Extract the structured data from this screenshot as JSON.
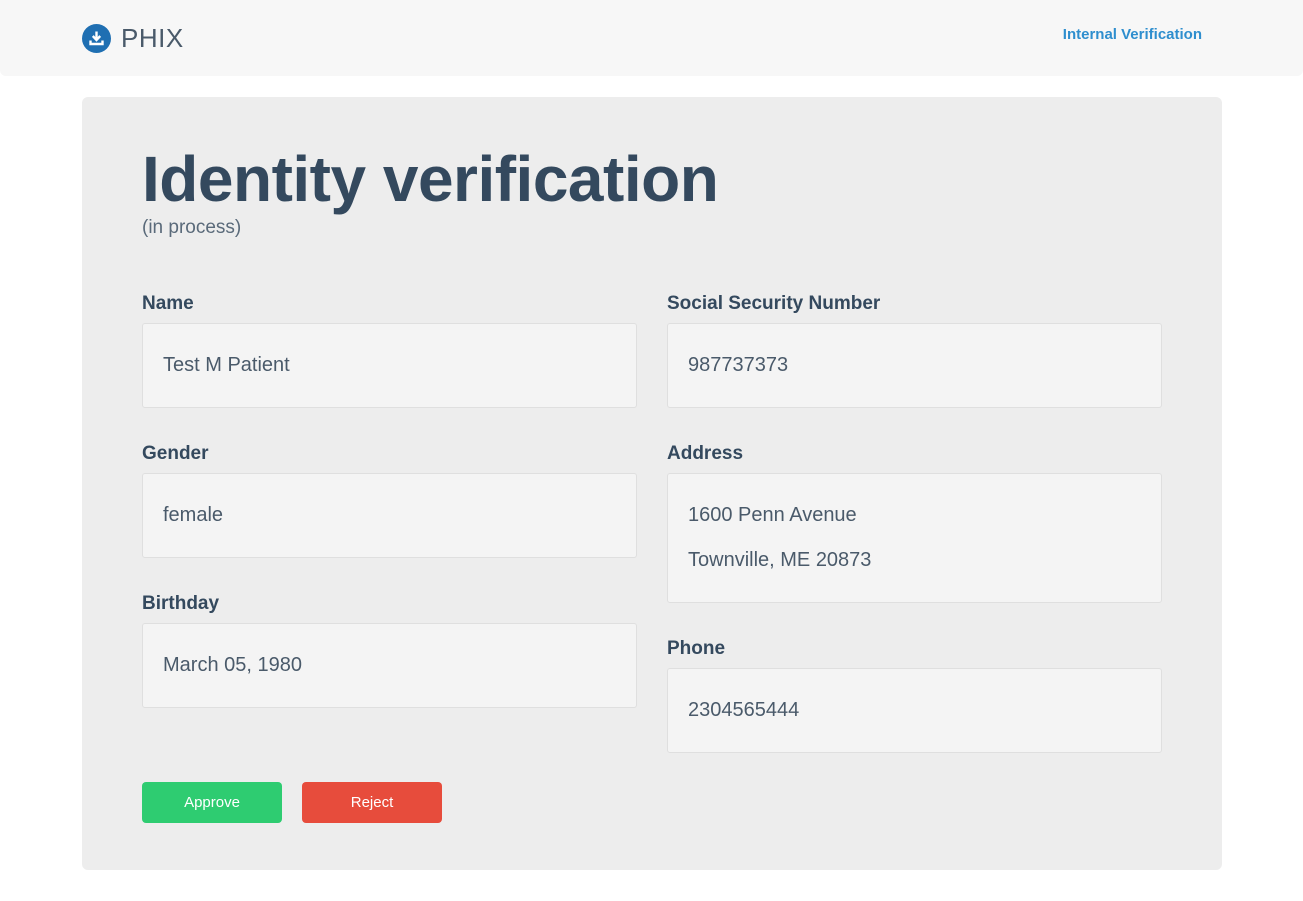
{
  "header": {
    "brand": "PHIX",
    "brand_icon": "download-icon",
    "nav_link": "Internal Verification",
    "colors": {
      "brand_icon": "#1f6fb2",
      "link": "#2e8ece"
    }
  },
  "main": {
    "title": "Identity verification",
    "subtitle": "(in process)",
    "fields": {
      "name": {
        "label": "Name",
        "value": "Test M Patient"
      },
      "ssn": {
        "label": "Social Security Number",
        "value": "987737373"
      },
      "gender": {
        "label": "Gender",
        "value": "female"
      },
      "address": {
        "label": "Address",
        "line1": "1600 Penn Avenue",
        "line2": "Townville, ME 20873"
      },
      "birthday": {
        "label": "Birthday",
        "value": "March 05, 1980"
      },
      "phone": {
        "label": "Phone",
        "value": "2304565444"
      }
    },
    "actions": {
      "approve": "Approve",
      "reject": "Reject",
      "colors": {
        "approve": "#2ecc71",
        "reject": "#e74c3c"
      }
    }
  }
}
